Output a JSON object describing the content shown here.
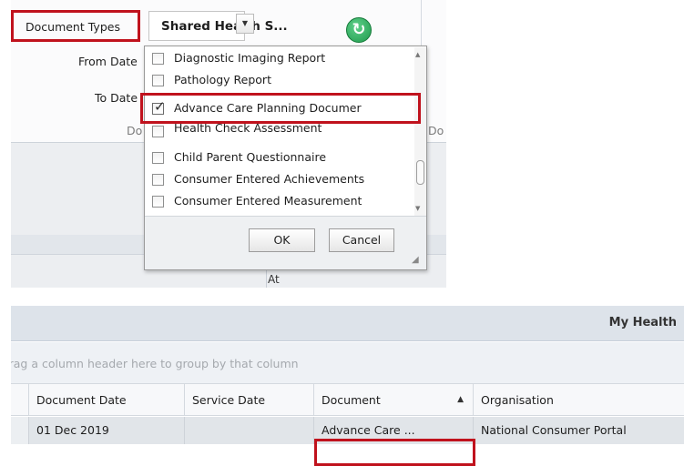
{
  "filter_panel": {
    "document_types_label": "Document Types",
    "document_types_value": "Shared Health S...",
    "from_date_label": "From Date",
    "to_date_label": "To Date",
    "group_caption_left": "Do",
    "group_caption_right": "Do",
    "aux_text": "At"
  },
  "dropdown": {
    "items": [
      {
        "label": "Diagnostic Imaging Report",
        "checked": false
      },
      {
        "label": "Pathology Report",
        "checked": false
      },
      {
        "label": "Advance Care Planning Documer",
        "checked": true
      },
      {
        "label": "Health Check Assessment",
        "checked": false
      },
      {
        "label": "Child Parent Questionnaire",
        "checked": false
      },
      {
        "label": "Consumer Entered Achievements",
        "checked": false
      },
      {
        "label": "Consumer Entered Measurement",
        "checked": false
      }
    ],
    "ok_label": "OK",
    "cancel_label": "Cancel"
  },
  "grid": {
    "panel_title": "My Health",
    "group_hint": "Drag a column header here to group by that column",
    "columns": [
      "Document Date",
      "Service Date",
      "Document",
      "Organisation"
    ],
    "rows": [
      [
        "01 Dec 2019",
        "",
        "Advance Care ...",
        "National Consumer Portal"
      ]
    ]
  },
  "colors": {
    "highlight": "#c0121d",
    "ribbon_bg": "#fbfbfc",
    "selected_row": "#e1e5e9"
  }
}
